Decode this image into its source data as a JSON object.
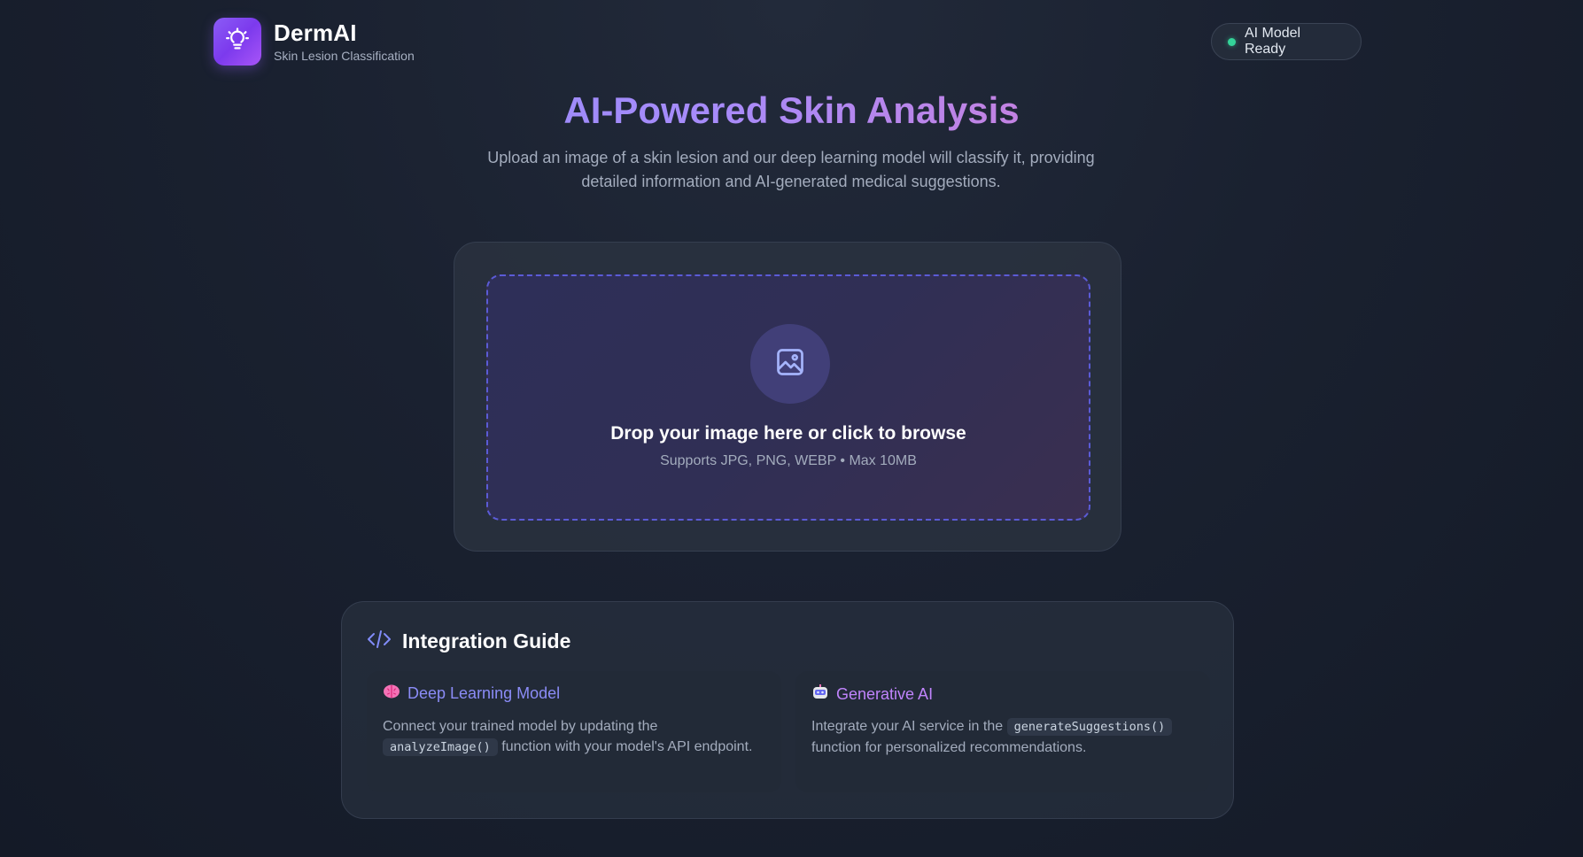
{
  "header": {
    "brand_name": "DermAI",
    "brand_subtitle": "Skin Lesion Classification",
    "logo_icon": "lightbulb-icon",
    "status_label": "AI Model Ready",
    "status_color": "#34d399"
  },
  "hero": {
    "title": "AI-Powered Skin Analysis",
    "description": "Upload an image of a skin lesion and our deep learning model will classify it, providing detailed information and AI-generated medical suggestions."
  },
  "upload": {
    "icon": "image-icon",
    "title": "Drop your image here or click to browse",
    "hint": "Supports JPG, PNG, WEBP • Max 10MB"
  },
  "guide": {
    "icon": "code-icon",
    "title": "Integration Guide",
    "deep_learning": {
      "icon": "brain-icon",
      "title": "Deep Learning Model",
      "text_before": "Connect your trained model by updating the",
      "code": "analyzeImage()",
      "text_after": "function with your model's API endpoint."
    },
    "generative": {
      "icon": "robot-icon",
      "title": "Generative AI",
      "text_before": "Integrate your AI service in the",
      "code": "generateSuggestions()",
      "text_after": "function for personalized recommendations."
    }
  },
  "colors": {
    "accent_purple": "#8b5cf6",
    "gradient_start": "#818cf8",
    "gradient_end": "#f472b6",
    "background": "#1a2130"
  }
}
